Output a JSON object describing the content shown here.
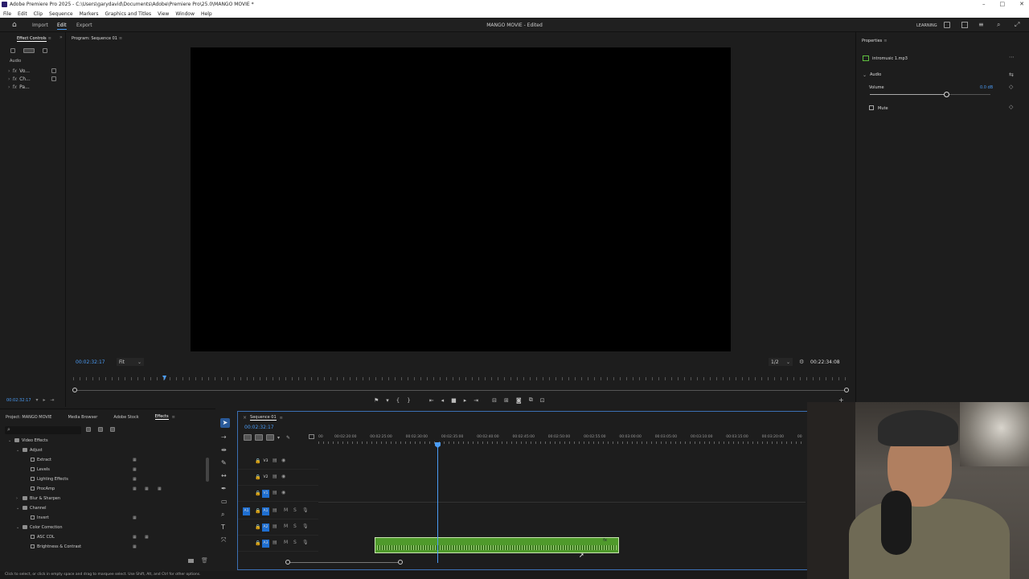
{
  "window": {
    "title": "Adobe Premiere Pro 2025 - C:\\Users\\garydavid\\Documents\\Adobe\\Premiere Pro\\25.0\\MANGO MOVIE *"
  },
  "menu": [
    "File",
    "Edit",
    "Clip",
    "Sequence",
    "Markers",
    "Graphics and Titles",
    "View",
    "Window",
    "Help"
  ],
  "header": {
    "nav": [
      "Import",
      "Edit",
      "Export"
    ],
    "active_nav": "Edit",
    "project_title": "MANGO MOVIE - Edited",
    "learning_label": "LEARNING"
  },
  "effect_controls": {
    "tab": "Effect Controls",
    "section": "Audio",
    "items": [
      "Vo...",
      "Ch...",
      "Pa..."
    ],
    "timecode": "00:02:32:17"
  },
  "program_monitor": {
    "tab": "Program: Sequence 01",
    "timecode": "00:02:32:17",
    "fit": "Fit",
    "resolution": "1/2",
    "duration": "00:22:34:08",
    "playhead_progress": 0.115
  },
  "properties": {
    "tab": "Properties",
    "clip_name": "intromusic 1.mp3",
    "section": "Audio",
    "volume_label": "Volume",
    "volume_value": "0.0 dB",
    "volume_level": 0.63,
    "mute_label": "Mute"
  },
  "project_panel": {
    "tabs": [
      "Project: MANGO MOVIE",
      "Media Browser",
      "Adobe Stock",
      "Effects"
    ],
    "active_tab": "Effects",
    "tree": [
      {
        "label": "Video Effects",
        "level": 0,
        "type": "folder",
        "expanded": true
      },
      {
        "label": "Adjust",
        "level": 1,
        "type": "folder",
        "expanded": true
      },
      {
        "label": "Extract",
        "level": 2,
        "type": "fx"
      },
      {
        "label": "Levels",
        "level": 2,
        "type": "fx"
      },
      {
        "label": "Lighting Effects",
        "level": 2,
        "type": "fx"
      },
      {
        "label": "ProcAmp",
        "level": 2,
        "type": "fx"
      },
      {
        "label": "Blur & Sharpen",
        "level": 1,
        "type": "folder",
        "expanded": false
      },
      {
        "label": "Channel",
        "level": 1,
        "type": "folder",
        "expanded": true
      },
      {
        "label": "Invert",
        "level": 2,
        "type": "fx"
      },
      {
        "label": "Color Correction",
        "level": 1,
        "type": "folder",
        "expanded": true
      },
      {
        "label": "ASC CDL",
        "level": 2,
        "type": "fx"
      },
      {
        "label": "Brightness & Contrast",
        "level": 2,
        "type": "fx"
      }
    ]
  },
  "timeline": {
    "tab": "Sequence 01",
    "timecode": "00:02:32:17",
    "ruler": [
      "00",
      "00:02:20:00",
      "00:02:25:00",
      "00:02:30:00",
      "00:02:35:00",
      "00:02:40:00",
      "00:02:45:00",
      "00:02:50:00",
      "00:02:55:00",
      "00:03:00:00",
      "00:03:05:00",
      "00:03:10:00",
      "00:03:15:00",
      "00:03:20:00",
      "00"
    ],
    "video_tracks": [
      "V3",
      "V2",
      "V1"
    ],
    "audio_tracks": [
      "A1",
      "A2",
      "A3"
    ],
    "audio_source": "A1",
    "track_buttons": {
      "mute": "M",
      "solo": "S"
    }
  },
  "status_bar": {
    "text": "Click to select, or click in empty space and drag to marquee select. Use Shift, Alt, and Ctrl for other options."
  },
  "colors": {
    "accent": "#4b9cf5",
    "clip_green": "#4f9a2b",
    "track_blue": "#1f6fd1"
  }
}
